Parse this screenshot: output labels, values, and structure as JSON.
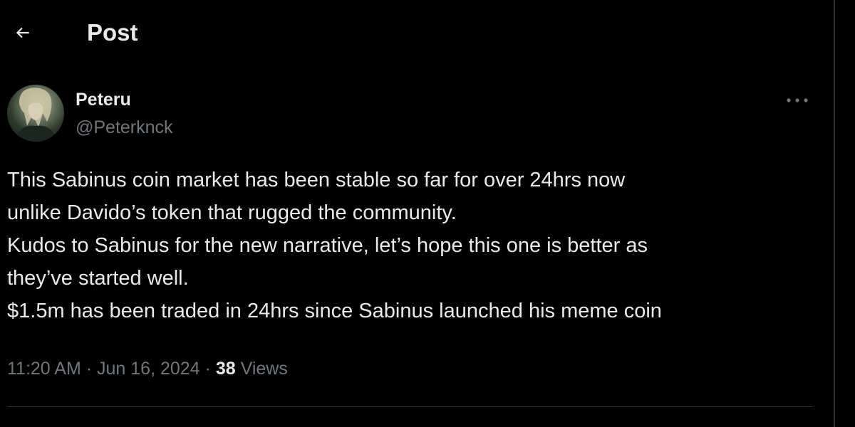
{
  "header": {
    "back_icon": "arrow-left-icon",
    "title": "Post"
  },
  "post": {
    "author": {
      "display_name": "Peteru",
      "handle": "@Peterknck",
      "avatar_icon": "avatar-image"
    },
    "more_icon": "more-horizontal-icon",
    "body_lines": [
      "This Sabinus coin market has been stable so far for over 24hrs now",
      "unlike Davido’s token that rugged the community.",
      "Kudos to Sabinus for the new narrative, let’s hope this one is better as",
      "they’ve started well.",
      "$1.5m has been traded in 24hrs since Sabinus launched his meme coin"
    ],
    "meta": {
      "time": "11:20 AM",
      "separator": "·",
      "date": "Jun 16, 2024",
      "views_count": "38",
      "views_label": "Views"
    }
  },
  "colors": {
    "background": "#000000",
    "text_primary": "#e7e9ea",
    "text_secondary": "#71767b",
    "border": "#2f3336"
  }
}
